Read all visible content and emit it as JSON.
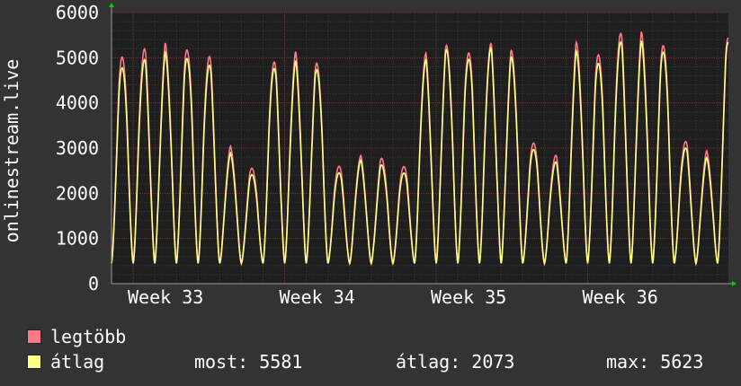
{
  "colors": {
    "background": "#333333",
    "plot_area": "#1f1f1f",
    "grid_major": "#6a3a3a",
    "grid_minor": "#3a3a3a",
    "axis": "#9a9a9a",
    "arrow": "#00cc00",
    "max_series": "#ff7a85",
    "avg_series": "#ffff88"
  },
  "legend": {
    "max_label": "legtöbb",
    "avg_label": "átlag"
  },
  "stats": {
    "now_label": "most:",
    "now_value": "5581",
    "avg_label": "átlag:",
    "avg_value": "2073",
    "max_label": "max:",
    "max_value": "5623"
  },
  "chart_data": {
    "type": "line",
    "ylabel": "onlinestream.live",
    "ylim": [
      0,
      6000
    ],
    "yticks": [
      "0",
      "1000",
      "2000",
      "3000",
      "4000",
      "5000",
      "6000"
    ],
    "x_range": [
      0,
      28.5
    ],
    "x_ticks": [
      {
        "label": "Week 33",
        "x": 2.5
      },
      {
        "label": "Week 34",
        "x": 9.5
      },
      {
        "label": "Week 35",
        "x": 16.5
      },
      {
        "label": "Week 36",
        "x": 23.5
      }
    ],
    "grid": true,
    "legend_position": "bottom-left",
    "daily_peaks": {
      "max": [
        5250,
        5350,
        5350,
        5400,
        5200,
        3050,
        2650,
        5100,
        5150,
        5050,
        2700,
        2850,
        2850,
        2700,
        5150,
        5400,
        5350,
        5400,
        5250,
        3250,
        2900,
        5400,
        5300,
        5700,
        5600,
        5500,
        3250,
        2950,
        5650
      ],
      "avg": [
        5000,
        5100,
        5150,
        5200,
        5000,
        2900,
        2500,
        4950,
        4950,
        4900,
        2550,
        2750,
        2700,
        2550,
        5000,
        5300,
        5200,
        5300,
        5100,
        3100,
        2750,
        5200,
        5100,
        5500,
        5400,
        5350,
        3100,
        2800,
        5550
      ]
    },
    "trough_value": 450,
    "last_value": 5581,
    "series": [
      {
        "name": "legtöbb",
        "color": "#ff7a85"
      },
      {
        "name": "átlag",
        "color": "#ffff88"
      }
    ]
  }
}
